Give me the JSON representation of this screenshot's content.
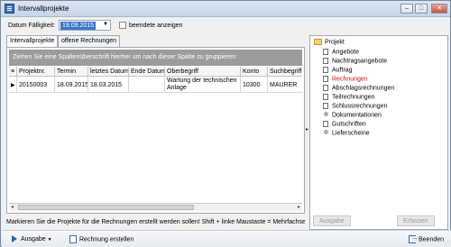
{
  "window": {
    "title": "Intervallprojekte",
    "controls": {
      "minimize": "–",
      "maximize": "□",
      "close": "✕"
    }
  },
  "filter": {
    "date_label": "Datum Fälligkeit:",
    "date_value": "19.09.2015",
    "dropdown_arrow": "▼",
    "checkbox_label": "beendete anzeigen",
    "checkbox_checked": false
  },
  "tabs": [
    {
      "label": "Intervallprojekte",
      "active": true
    },
    {
      "label": "offene Rechnungen",
      "active": false
    }
  ],
  "grid": {
    "group_hint": "Ziehen Sie eine Spaltenüberschrift hierher um nach dieser Spalte zu gruppieren",
    "indicator_header": "≡",
    "columns": [
      "Projektnr.",
      "Termin",
      "letztes Datum",
      "Ende Datum",
      "Oberbegriff",
      "Konto",
      "Suchbegriff"
    ],
    "rows": [
      {
        "indicator": "▶",
        "cells": [
          "20150003",
          "18.09.2015",
          "18.03.2015",
          "",
          "Wartung der technischen Anlage",
          "10300",
          "MAURER"
        ]
      }
    ],
    "scroll_left": "◂",
    "scroll_right": "▸"
  },
  "splitter_arrow": "▸",
  "tree": {
    "root": "Projekt",
    "items": [
      {
        "label": "Angebote",
        "icon": "document-icon",
        "highlight": false
      },
      {
        "label": "Nachtragsangebote",
        "icon": "document-icon",
        "highlight": false
      },
      {
        "label": "Auftrag",
        "icon": "document-icon",
        "highlight": false
      },
      {
        "label": "Rechnungen",
        "icon": "document-icon",
        "highlight": true
      },
      {
        "label": "Abschlagsrechnungen",
        "icon": "document-icon",
        "highlight": false
      },
      {
        "label": "Teilrechnungen",
        "icon": "document-icon",
        "highlight": false
      },
      {
        "label": "Schlussrechnungen",
        "icon": "document-icon",
        "highlight": false
      },
      {
        "label": "Dokumentationen",
        "icon": "gear-icon",
        "highlight": false
      },
      {
        "label": "Gutschriften",
        "icon": "document-icon",
        "highlight": false
      },
      {
        "label": "Lieferscheine",
        "icon": "gear-icon",
        "highlight": false
      }
    ]
  },
  "right_buttons": {
    "ausgabe": "Ausgabe",
    "erfassen": "Erfassen"
  },
  "status_message": "Markieren Sie die Projekte für die Rechnungen erstellt werden sollen! Shift + linke Maustaste = Mehrfachsel",
  "bottom": {
    "ausgabe": "Ausgabe",
    "rechnung": "Rechnung erstellen",
    "beenden": "Beenden"
  },
  "colors": {
    "highlight_red": "#d01010",
    "group_header": "#9c9c9c",
    "selection_blue": "#3a77c9"
  }
}
